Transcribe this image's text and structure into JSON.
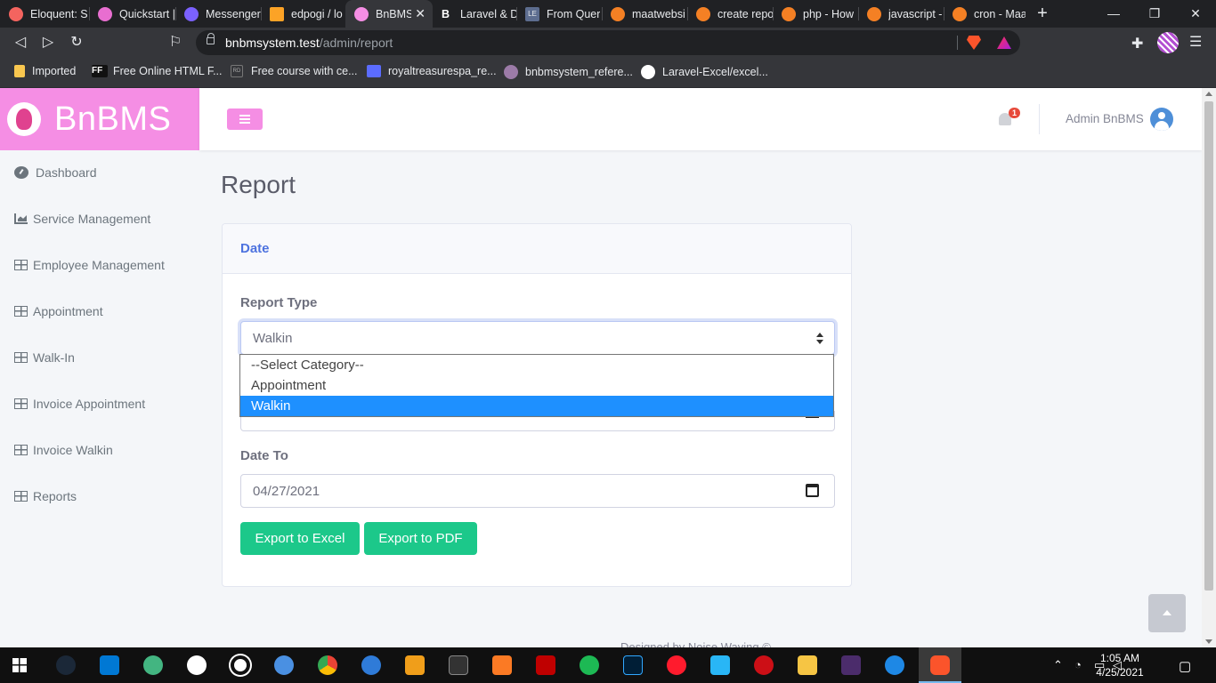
{
  "browser": {
    "tabs": [
      {
        "title": "Eloquent: S",
        "color": "#f4645f"
      },
      {
        "title": "Quickstart |",
        "color": "#e86ed0"
      },
      {
        "title": "Messenger",
        "color": "#7b61ff"
      },
      {
        "title": "edpogi / lo",
        "color": "#fca326"
      },
      {
        "title": "BnBMS",
        "color": "#f58ee4"
      },
      {
        "title": "Laravel & D",
        "color": "#202124"
      },
      {
        "title": "From Quer",
        "color": "#5d6d8f"
      },
      {
        "title": "maatwebsi",
        "color": "#f48024"
      },
      {
        "title": "create repo",
        "color": "#f48024"
      },
      {
        "title": "php - How",
        "color": "#f48024"
      },
      {
        "title": "javascript -",
        "color": "#f48024"
      },
      {
        "title": "cron - Maa",
        "color": "#f48024"
      }
    ],
    "tab_letter_laravel": "B",
    "tab_letter_from": "LE",
    "url_host": "bnbmsystem.test",
    "url_path": "/admin/report",
    "bookmarks": [
      {
        "label": "Imported",
        "color": "#f9c74f"
      },
      {
        "label": "Free Online HTML F...",
        "color": "#111111"
      },
      {
        "label": "Free course with ce...",
        "color": "#555555"
      },
      {
        "label": "royaltreasurespa_re...",
        "color": "#5b6cff"
      },
      {
        "label": "bnbmsystem_refere...",
        "color": "#9c7ba8"
      },
      {
        "label": "Laravel-Excel/excel...",
        "color": "#ffffff"
      }
    ],
    "bookmark_ff": "FF",
    "bookmark_rd": "RD"
  },
  "app": {
    "brand": "BnBMS",
    "sidebar": [
      {
        "label": "Dashboard",
        "icon": "dashboard-icon"
      },
      {
        "label": "Service Management",
        "icon": "chart-area-icon"
      },
      {
        "label": "Employee Management",
        "icon": "table-icon"
      },
      {
        "label": "Appointment",
        "icon": "table-icon"
      },
      {
        "label": "Walk-In",
        "icon": "table-icon"
      },
      {
        "label": "Invoice Appointment",
        "icon": "table-icon"
      },
      {
        "label": "Invoice Walkin",
        "icon": "table-icon"
      },
      {
        "label": "Reports",
        "icon": "table-icon"
      }
    ],
    "notification_count": "1",
    "user_name": "Admin BnBMS",
    "page_title": "Report",
    "card_header": "Date",
    "report_type_label": "Report Type",
    "report_type_value": "Walkin",
    "report_type_options": [
      "--Select Category--",
      "Appointment",
      "Walkin"
    ],
    "date_to_label": "Date To",
    "date_to_value": "04/27/2021",
    "export_excel": "Export to Excel",
    "export_pdf": "Export to PDF",
    "footer": "Designed by Noise Waving ©",
    "colors": {
      "brand": "#f58ee4",
      "primary": "#4e73df",
      "success": "#1cc88a",
      "selected_option": "#1e90ff"
    }
  },
  "taskbar": {
    "time": "1:05 AM",
    "date": "4/25/2021"
  }
}
